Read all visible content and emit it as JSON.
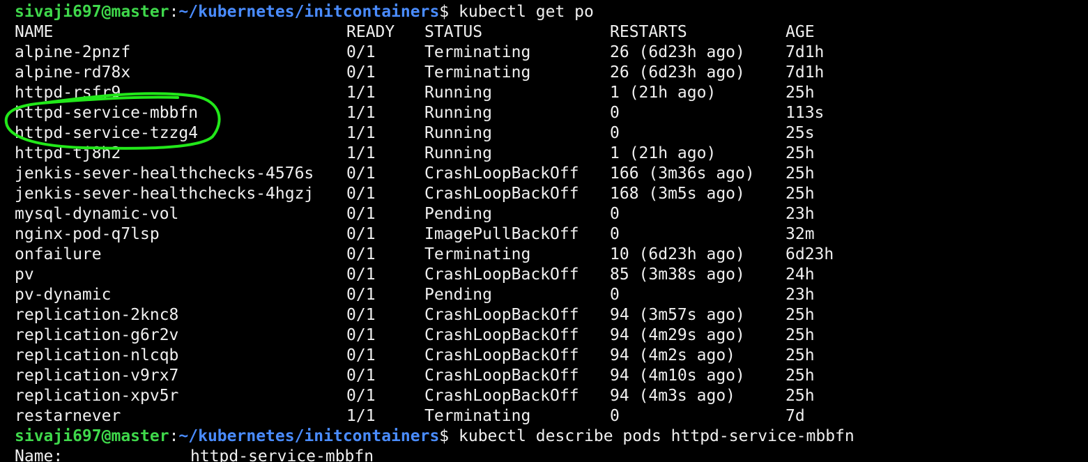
{
  "prompt": {
    "user_host": "sivaji697@master",
    "separator": ":",
    "path": "~/kubernetes/initcontainers",
    "symbol": "$"
  },
  "commands": {
    "first": "kubectl get po",
    "second": "kubectl describe pods httpd-service-mbbfn"
  },
  "table": {
    "headers": {
      "name": "NAME",
      "ready": "READY",
      "status": "STATUS",
      "restarts": "RESTARTS",
      "age": "AGE"
    },
    "rows": [
      {
        "name": "alpine-2pnzf",
        "ready": "0/1",
        "status": "Terminating",
        "restarts": "26 (6d23h ago)",
        "age": "7d1h"
      },
      {
        "name": "alpine-rd78x",
        "ready": "0/1",
        "status": "Terminating",
        "restarts": "26 (6d23h ago)",
        "age": "7d1h"
      },
      {
        "name": "httpd-rsfr9",
        "ready": "1/1",
        "status": "Running",
        "restarts": "1 (21h ago)",
        "age": "25h"
      },
      {
        "name": "httpd-service-mbbfn",
        "ready": "1/1",
        "status": "Running",
        "restarts": "0",
        "age": "113s"
      },
      {
        "name": "httpd-service-tzzg4",
        "ready": "1/1",
        "status": "Running",
        "restarts": "0",
        "age": "25s"
      },
      {
        "name": "httpd-tj8h2",
        "ready": "1/1",
        "status": "Running",
        "restarts": "1 (21h ago)",
        "age": "25h"
      },
      {
        "name": "jenkis-sever-healthchecks-4576s",
        "ready": "0/1",
        "status": "CrashLoopBackOff",
        "restarts": "166 (3m36s ago)",
        "age": "25h"
      },
      {
        "name": "jenkis-sever-healthchecks-4hgzj",
        "ready": "0/1",
        "status": "CrashLoopBackOff",
        "restarts": "168 (3m5s ago)",
        "age": "25h"
      },
      {
        "name": "mysql-dynamic-vol",
        "ready": "0/1",
        "status": "Pending",
        "restarts": "0",
        "age": "23h"
      },
      {
        "name": "nginx-pod-q7lsp",
        "ready": "0/1",
        "status": "ImagePullBackOff",
        "restarts": "0",
        "age": "32m"
      },
      {
        "name": "onfailure",
        "ready": "0/1",
        "status": "Terminating",
        "restarts": "10 (6d23h ago)",
        "age": "6d23h"
      },
      {
        "name": "pv",
        "ready": "0/1",
        "status": "CrashLoopBackOff",
        "restarts": "85 (3m38s ago)",
        "age": "24h"
      },
      {
        "name": "pv-dynamic",
        "ready": "0/1",
        "status": "Pending",
        "restarts": "0",
        "age": "23h"
      },
      {
        "name": "replication-2knc8",
        "ready": "0/1",
        "status": "CrashLoopBackOff",
        "restarts": "94 (3m57s ago)",
        "age": "25h"
      },
      {
        "name": "replication-g6r2v",
        "ready": "0/1",
        "status": "CrashLoopBackOff",
        "restarts": "94 (4m29s ago)",
        "age": "25h"
      },
      {
        "name": "replication-nlcqb",
        "ready": "0/1",
        "status": "CrashLoopBackOff",
        "restarts": "94 (4m2s ago)",
        "age": "25h"
      },
      {
        "name": "replication-v9rx7",
        "ready": "0/1",
        "status": "CrashLoopBackOff",
        "restarts": "94 (4m10s ago)",
        "age": "25h"
      },
      {
        "name": "replication-xpv5r",
        "ready": "0/1",
        "status": "CrashLoopBackOff",
        "restarts": "94 (4m3s ago)",
        "age": "25h"
      },
      {
        "name": "restarnever",
        "ready": "1/1",
        "status": "Terminating",
        "restarts": "0",
        "age": "7d"
      }
    ]
  },
  "describe_output": {
    "label": "Name:",
    "value": "httpd-service-mbbfn"
  },
  "colors": {
    "background": "#000000",
    "text": "#f0f0f0",
    "prompt_user": "#3fd84b",
    "prompt_path": "#4a8cff",
    "annotation_circle": "#22e81a"
  },
  "annotation": {
    "icon": "hand-drawn-circle-icon"
  }
}
